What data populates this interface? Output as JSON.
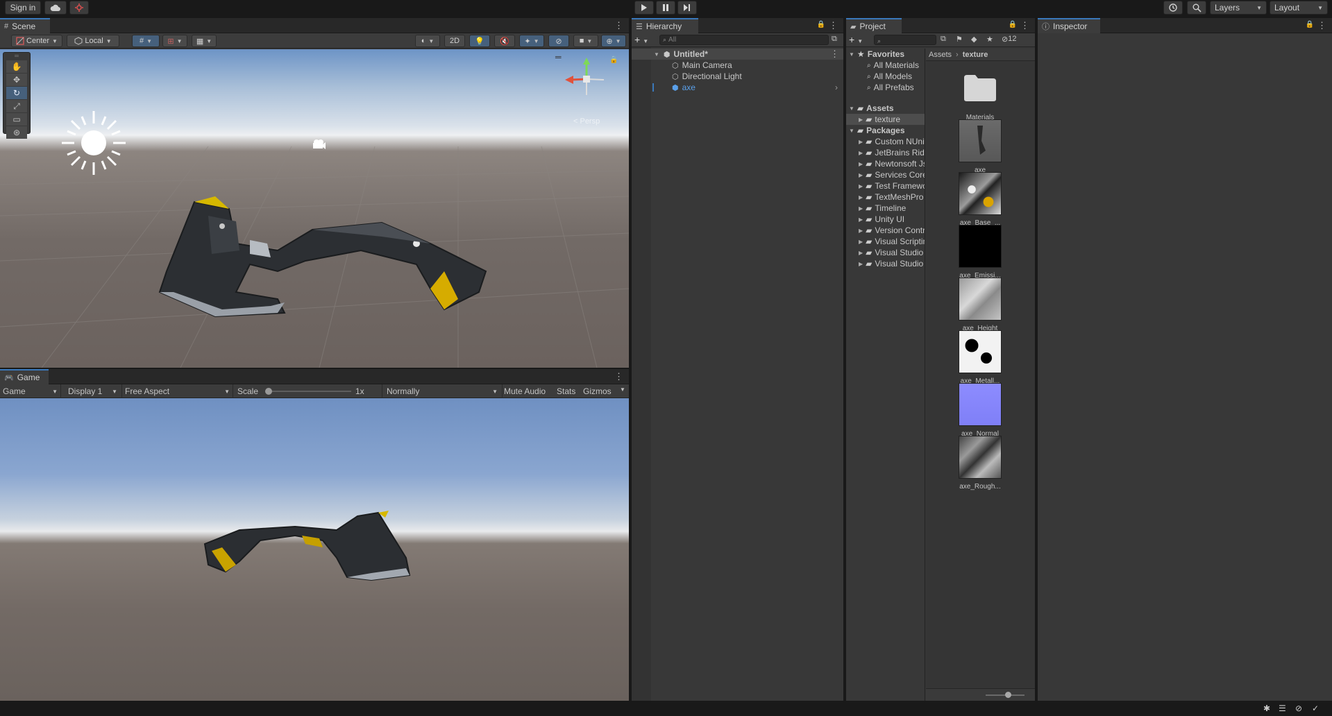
{
  "topbar": {
    "sign_in": "Sign in",
    "cloud_icon": "cloud-icon",
    "collab_icon": "collab-icon",
    "play_icon": "play-icon",
    "pause_icon": "pause-icon",
    "step_icon": "step-icon",
    "history_icon": "history-icon",
    "search_icon": "search-icon",
    "layers_label": "Layers",
    "layout_label": "Layout"
  },
  "scene": {
    "tab_label": "Scene",
    "pivot_label": "Center",
    "space_label": "Local",
    "mode_2d": "2D",
    "persp_label": "< Persp"
  },
  "game": {
    "tab_label": "Game",
    "view_dropdown": "Game",
    "display_dropdown": "Display 1",
    "aspect_dropdown": "Free Aspect",
    "scale_label": "Scale",
    "scale_value": "1x",
    "scale_fraction": 0.0,
    "play_mode_dropdown": "Normally",
    "mute_audio": "Mute Audio",
    "stats": "Stats",
    "gizmos": "Gizmos"
  },
  "hierarchy": {
    "tab_label": "Hierarchy",
    "search_placeholder": "All",
    "scene_name": "Untitled*",
    "items": [
      {
        "label": "Main Camera"
      },
      {
        "label": "Directional Light"
      },
      {
        "label": "axe"
      }
    ]
  },
  "project": {
    "tab_label": "Project",
    "hidden_count": "12",
    "favorites_label": "Favorites",
    "favorites": [
      "All Materials",
      "All Models",
      "All Prefabs"
    ],
    "assets_label": "Assets",
    "assets_children": [
      "texture"
    ],
    "packages_label": "Packages",
    "packages": [
      "Custom NUnit",
      "JetBrains Rider Editor",
      "Newtonsoft Json",
      "Services Core",
      "Test Framework",
      "TextMeshPro",
      "Timeline",
      "Unity UI",
      "Version Control",
      "Visual Scripting",
      "Visual Studio Code Editor",
      "Visual Studio Editor"
    ],
    "breadcrumb": [
      "Assets",
      "texture"
    ],
    "grid_items": [
      {
        "name": "Materials",
        "kind": "folder"
      },
      {
        "name": "axe",
        "kind": "model"
      },
      {
        "name": "axe_Base_...",
        "kind": "base"
      },
      {
        "name": "axe_Emissi...",
        "kind": "emission"
      },
      {
        "name": "axe_Height",
        "kind": "height"
      },
      {
        "name": "axe_Metall...",
        "kind": "metallic"
      },
      {
        "name": "axe_Normal",
        "kind": "normal"
      },
      {
        "name": "axe_Rough...",
        "kind": "rough"
      }
    ]
  },
  "inspector": {
    "tab_label": "Inspector"
  },
  "colors": {
    "accent": "#3a79bb",
    "selected_text": "#5aa0ea"
  }
}
